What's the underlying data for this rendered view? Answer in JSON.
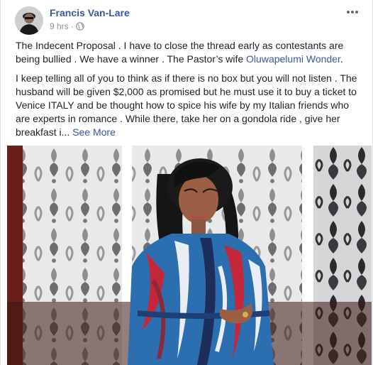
{
  "post": {
    "author": "Francis Van-Lare",
    "time": "9 hrs",
    "dot": "·",
    "more_icon": "more-dots-icon",
    "privacy_icon": "globe-icon",
    "p1_text": "The Indecent Proposal . I have to close the thread early as contestants are being bullied . We have a winner . The Pastor’s wife ",
    "p1_mention": "Oluwapelumi Wonder",
    "p1_end": ".",
    "p2_text": "I keep telling all of you to think as if there is no box but you will not listen . The husband will be given $2,000 as promised but he must use it to buy a ticket to Venice ITALY and be thought how to spice his wife by my Italian friends who are experts in romance . While there, take her on a gondola ride , give her breakfast i... ",
    "see_more": "See More"
  },
  "colors": {
    "link": "#385898",
    "text": "#1d2129",
    "meta": "#90949c"
  }
}
